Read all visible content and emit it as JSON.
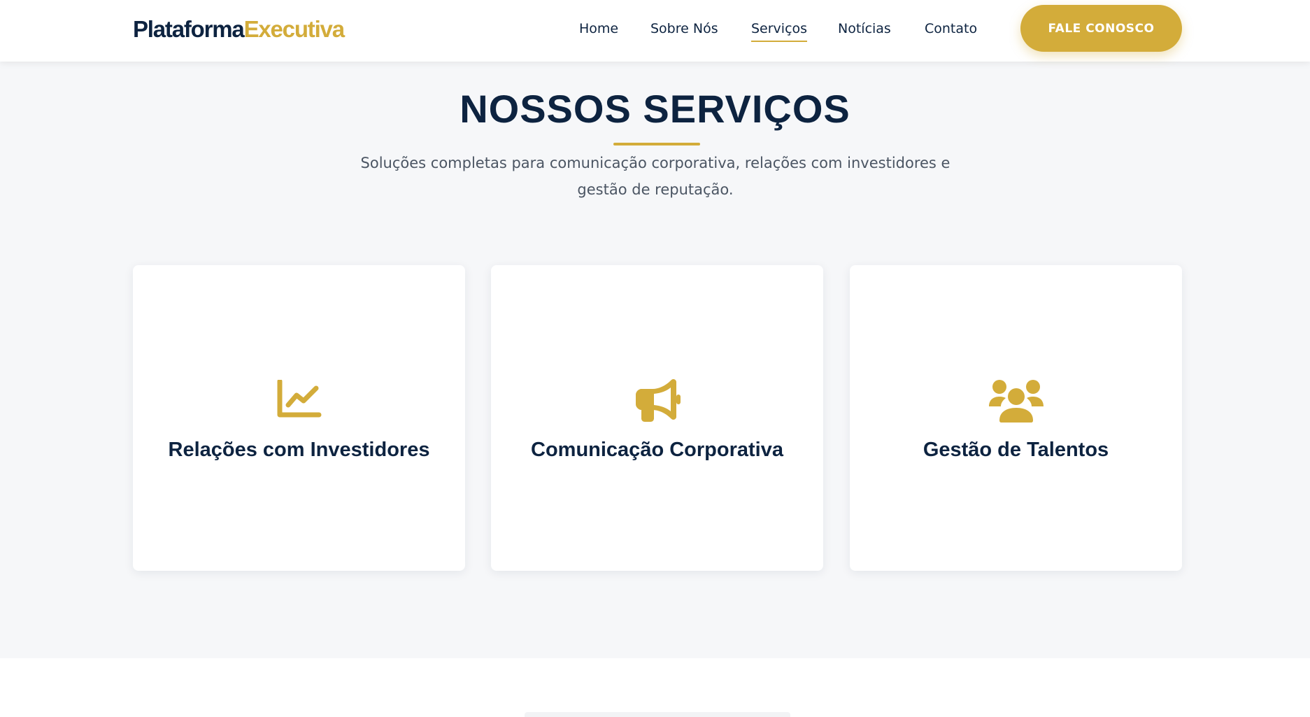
{
  "header": {
    "logo_part1": "Plataforma",
    "logo_part2": "Executiva",
    "nav": [
      "Home",
      "Sobre Nós",
      "Serviços",
      "Notícias",
      "Contato"
    ],
    "active_nav": "Serviços",
    "cta_label": "FALE CONOSCO"
  },
  "services": {
    "title": "NOSSOS SERVIÇOS",
    "subtitle_line1": "Soluções completas para comunicação corporativa, relações com investidores e",
    "subtitle_line2": "gestão de reputação.",
    "cards": [
      {
        "icon": "chart-line-icon",
        "title": "Relações com Investidores"
      },
      {
        "icon": "megaphone-icon",
        "title": "Comunicação Corporativa"
      },
      {
        "icon": "users-icon",
        "title": "Gestão de Talentos"
      }
    ]
  },
  "colors": {
    "navy": "#0d2340",
    "gold": "#d3ac3a",
    "section_bg": "#f6f7f9"
  }
}
